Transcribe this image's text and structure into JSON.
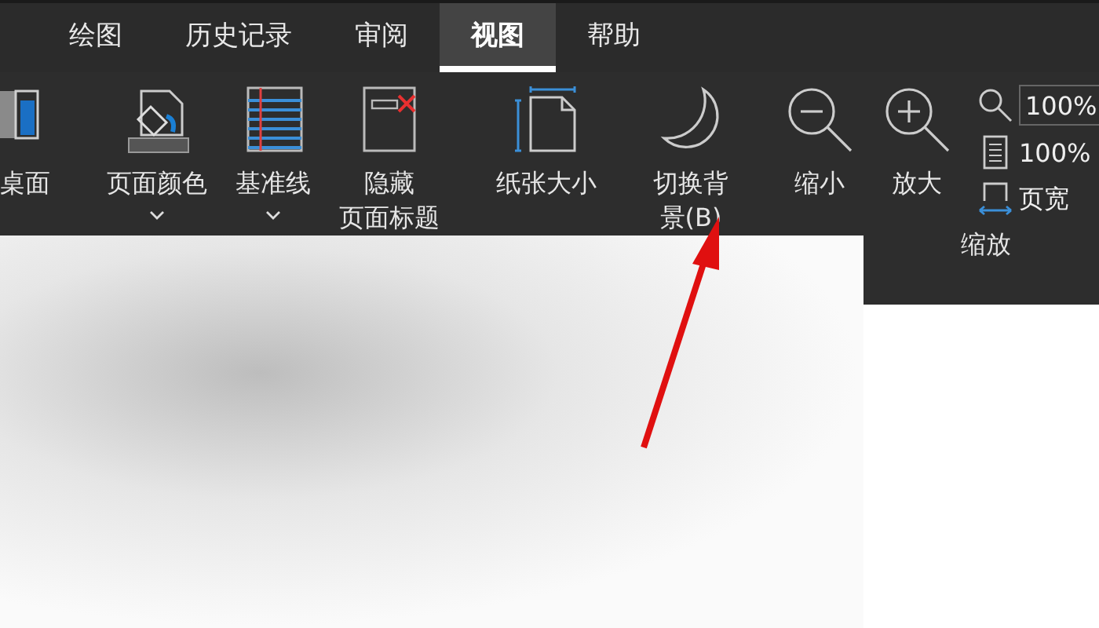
{
  "tabs": [
    {
      "label": "绘图",
      "selected": false
    },
    {
      "label": "历史记录",
      "selected": false
    },
    {
      "label": "审阅",
      "selected": false
    },
    {
      "label": "视图",
      "selected": true
    },
    {
      "label": "帮助",
      "selected": false
    }
  ],
  "ribbon": {
    "groups": [
      {
        "buttons": [
          {
            "lines": [
              "桌面"
            ],
            "dropdown": false
          }
        ]
      },
      {
        "buttons": [
          {
            "lines": [
              "页面颜色"
            ],
            "dropdown": true
          },
          {
            "lines": [
              "基准线"
            ],
            "dropdown": true
          },
          {
            "lines": [
              "隐藏",
              "页面标题"
            ],
            "dropdown": false
          }
        ]
      },
      {
        "buttons": [
          {
            "lines": [
              "纸张大小"
            ],
            "dropdown": false
          }
        ]
      },
      {
        "buttons": [
          {
            "lines": [
              "切换背",
              "景(B)"
            ],
            "dropdown": false
          }
        ]
      },
      {
        "label": "缩放",
        "buttons": [
          {
            "lines": [
              "缩小"
            ],
            "dropdown": false
          },
          {
            "lines": [
              "放大"
            ],
            "dropdown": false
          }
        ],
        "small": [
          {
            "kind": "input",
            "value": "100%"
          },
          {
            "kind": "button",
            "label": "100%"
          },
          {
            "kind": "button",
            "label": "页宽"
          }
        ]
      }
    ]
  }
}
